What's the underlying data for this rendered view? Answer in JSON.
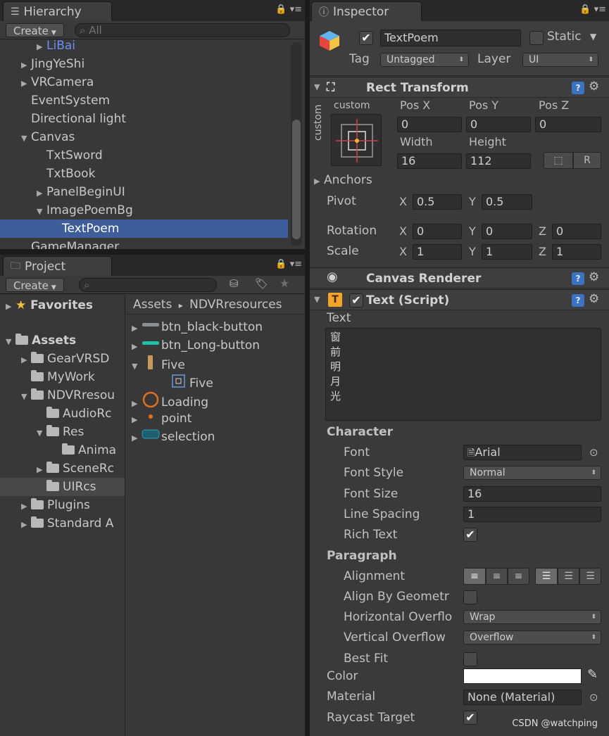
{
  "hierarchy": {
    "tab_label": "Hierarchy",
    "create_label": "Create",
    "search_placeholder": "All",
    "items": [
      {
        "label": "LiBai",
        "depth": 1,
        "arrow": "▶",
        "color": "#6b8ff0"
      },
      {
        "label": "JingYeShi",
        "depth": 0,
        "arrow": "▶"
      },
      {
        "label": "VRCamera",
        "depth": 0,
        "arrow": "▶"
      },
      {
        "label": "EventSystem",
        "depth": 0,
        "arrow": ""
      },
      {
        "label": "Directional light",
        "depth": 0,
        "arrow": ""
      },
      {
        "label": "Canvas",
        "depth": 0,
        "arrow": "▼"
      },
      {
        "label": "TxtSword",
        "depth": 1,
        "arrow": ""
      },
      {
        "label": "TxtBook",
        "depth": 1,
        "arrow": ""
      },
      {
        "label": "PanelBeginUI",
        "depth": 1,
        "arrow": "▶"
      },
      {
        "label": "ImagePoemBg",
        "depth": 1,
        "arrow": "▼"
      },
      {
        "label": "TextPoem",
        "depth": 2,
        "arrow": "",
        "selected": true
      },
      {
        "label": "GameManager",
        "depth": 0,
        "arrow": ""
      }
    ]
  },
  "project": {
    "tab_label": "Project",
    "create_label": "Create",
    "favorites_label": "Favorites",
    "assets_label": "Assets",
    "folders": [
      {
        "label": "GearVRSD",
        "depth": 1,
        "arrow": "▶"
      },
      {
        "label": "MyWork",
        "depth": 1,
        "arrow": ""
      },
      {
        "label": "NDVRresou",
        "depth": 1,
        "arrow": "▼"
      },
      {
        "label": "AudioRc",
        "depth": 2,
        "arrow": ""
      },
      {
        "label": "Res",
        "depth": 2,
        "arrow": "▼"
      },
      {
        "label": "Anima",
        "depth": 3,
        "arrow": ""
      },
      {
        "label": "SceneRc",
        "depth": 2,
        "arrow": "▶"
      },
      {
        "label": "UIRcs",
        "depth": 2,
        "arrow": "",
        "selected": true
      },
      {
        "label": "Plugins",
        "depth": 1,
        "arrow": "▶"
      },
      {
        "label": "Standard A",
        "depth": 1,
        "arrow": "▶"
      }
    ],
    "breadcrumb_root": "Assets",
    "breadcrumb_sep": "▸",
    "breadcrumb_current": "NDVRresources",
    "files": [
      {
        "label": "btn_black-button",
        "depth": 0,
        "arrow": "▶",
        "icon": "bar-gray"
      },
      {
        "label": "btn_Long-button",
        "depth": 0,
        "arrow": "▶",
        "icon": "bar-teal"
      },
      {
        "label": "Five",
        "depth": 0,
        "arrow": "▼",
        "icon": "tall-bar"
      },
      {
        "label": "Five",
        "depth": 1,
        "arrow": "",
        "icon": "sprite"
      },
      {
        "label": "Loading",
        "depth": 0,
        "arrow": "▶",
        "icon": "ring"
      },
      {
        "label": "point",
        "depth": 0,
        "arrow": "▶",
        "icon": "dot"
      },
      {
        "label": "selection",
        "depth": 0,
        "arrow": "▶",
        "icon": "rounded-rect"
      }
    ]
  },
  "inspector": {
    "tab_label": "Inspector",
    "object_name": "TextPoem",
    "active_checked": "✔",
    "static_label": "Static",
    "tag_label": "Tag",
    "tag_value": "Untagged",
    "layer_label": "Layer",
    "layer_value": "UI",
    "rect_transform": {
      "title": "Rect Transform",
      "anchor_preset_top": "custom",
      "anchor_preset_side": "custom",
      "posx_label": "Pos X",
      "posy_label": "Pos Y",
      "posz_label": "Pos Z",
      "posx": "0",
      "posy": "0",
      "posz": "0",
      "width_label": "Width",
      "height_label": "Height",
      "width": "16",
      "height": "112",
      "r_button": "R",
      "anchors_label": "Anchors",
      "pivot_label": "Pivot",
      "pivot_x": "0.5",
      "pivot_y": "0.5",
      "rotation_label": "Rotation",
      "rot_x": "0",
      "rot_y": "0",
      "rot_z": "0",
      "scale_label": "Scale",
      "scale_x": "1",
      "scale_y": "1",
      "scale_z": "1",
      "x_axis": "X",
      "y_axis": "Y",
      "z_axis": "Z"
    },
    "canvas_renderer": {
      "title": "Canvas Renderer"
    },
    "text_script": {
      "title": "Text (Script)",
      "text_label": "Text",
      "text_lines": [
        "窗",
        "前",
        "明",
        "月",
        "光"
      ],
      "character_label": "Character",
      "font_label": "Font",
      "font_value": "Arial",
      "font_style_label": "Font Style",
      "font_style_value": "Normal",
      "font_size_label": "Font Size",
      "font_size_value": "16",
      "line_spacing_label": "Line Spacing",
      "line_spacing_value": "1",
      "rich_text_label": "Rich Text",
      "rich_text_checked": "✔",
      "paragraph_label": "Paragraph",
      "alignment_label": "Alignment",
      "align_geom_label": "Align By Geometr",
      "h_overflow_label": "Horizontal Overflo",
      "h_overflow_value": "Wrap",
      "v_overflow_label": "Vertical Overflow",
      "v_overflow_value": "Overflow",
      "best_fit_label": "Best Fit",
      "color_label": "Color",
      "color_value": "#ffffff",
      "material_label": "Material",
      "material_value": "None (Material)",
      "raycast_label": "Raycast Target",
      "raycast_checked": "✔"
    }
  },
  "watermark": "CSDN @watchping"
}
